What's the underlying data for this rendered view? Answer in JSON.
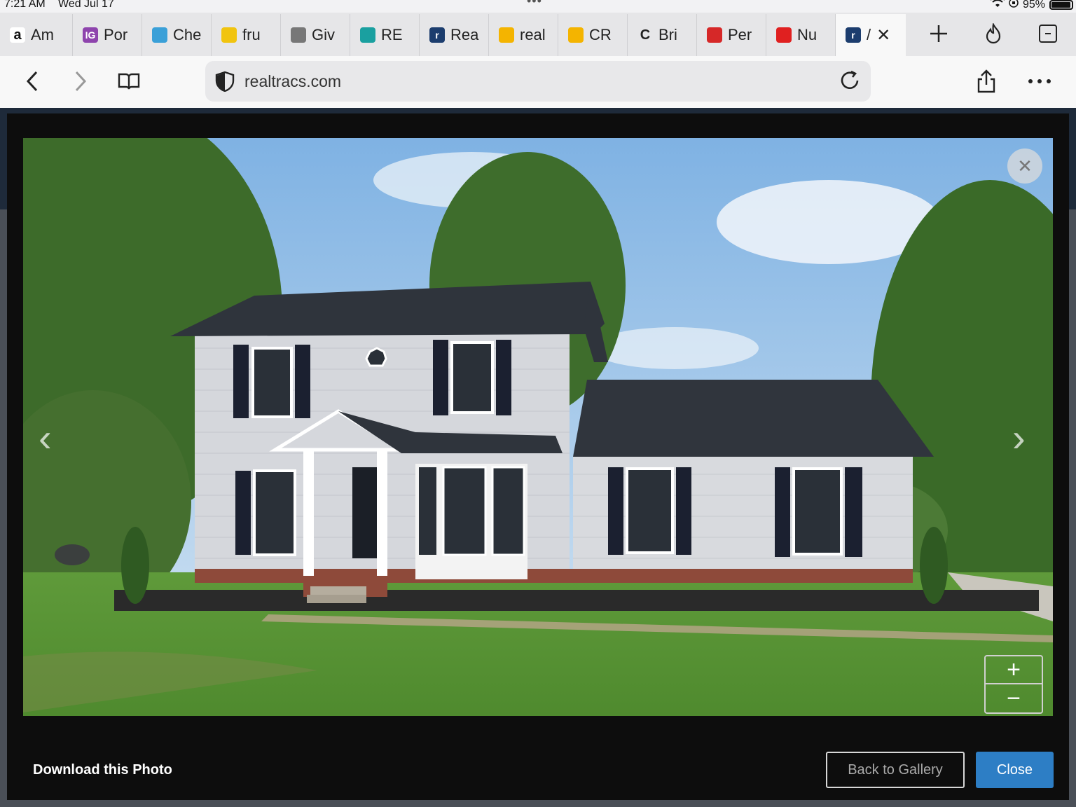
{
  "status_bar": {
    "time": "7:21 AM",
    "date": "Wed Jul 17",
    "battery_percent": "95%",
    "battery_level": 0.95
  },
  "tabs": [
    {
      "label": "Am",
      "icon": "amazon-icon",
      "color": "#ffffff"
    },
    {
      "label": "Por",
      "icon": "ig-icon",
      "color": "#8e44ad"
    },
    {
      "label": "Che",
      "icon": "heart-icon",
      "color": "#3aa0d8"
    },
    {
      "label": "fru",
      "icon": "pin-icon",
      "color": "#f1c40f"
    },
    {
      "label": "Giv",
      "icon": "gear-icon",
      "color": "#777777"
    },
    {
      "label": "RE",
      "icon": "house-icon",
      "color": "#1aa0a0"
    },
    {
      "label": "Rea",
      "icon": "realtracs-icon",
      "color": "#1c3d6e"
    },
    {
      "label": "real",
      "icon": "sign-icon",
      "color": "#f4b400"
    },
    {
      "label": "CR",
      "icon": "sign-icon",
      "color": "#f4b400"
    },
    {
      "label": "Bri",
      "icon": "c-icon",
      "color": "#222222"
    },
    {
      "label": "Per",
      "icon": "target-icon",
      "color": "#d62828"
    },
    {
      "label": "Nu",
      "icon": "youtube-icon",
      "color": "#e02020"
    },
    {
      "label": "/",
      "icon": "realtracs-icon",
      "color": "#1c3d6e",
      "active": true
    }
  ],
  "url": "realtracs.com",
  "modal": {
    "download_label": "Download this Photo",
    "back_label": "Back to Gallery",
    "close_label": "Close",
    "zoom_in": "+",
    "zoom_out": "−"
  },
  "colors": {
    "accent": "#2d7ec5",
    "modal_bg": "#0d0d0d"
  }
}
